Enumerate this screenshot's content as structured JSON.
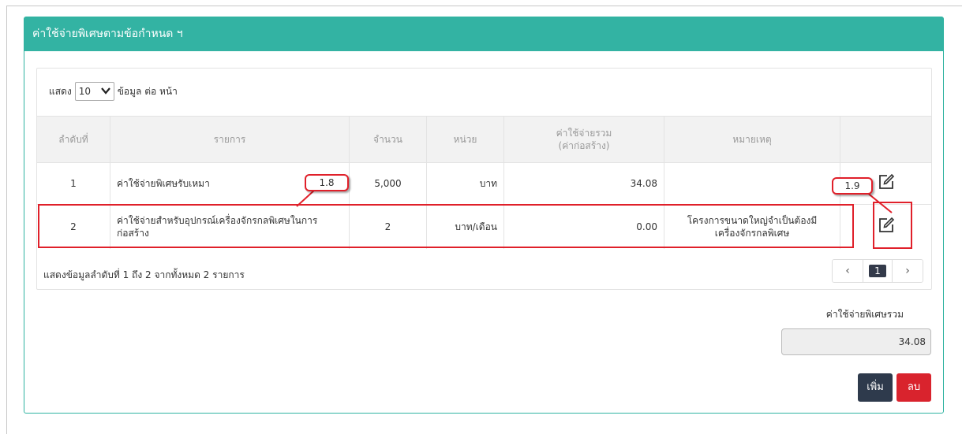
{
  "panel": {
    "title": "ค่าใช้จ่ายพิเศษตามข้อกำหนด ฯ"
  },
  "length_menu": {
    "prefix": "แสดง",
    "value": "10",
    "suffix": "ข้อมูล ต่อ หน้า"
  },
  "table": {
    "headers": {
      "no": "ลำดับที่",
      "item": "รายการ",
      "qty": "จำนวน",
      "unit": "หน่วย",
      "cost_line1": "ค่าใช้จ่ายรวม",
      "cost_line2": "(ค่าก่อสร้าง)",
      "note": "หมายเหตุ"
    },
    "rows": [
      {
        "no": "1",
        "item": "ค่าใช้จ่ายพิเศษรับเหมา",
        "qty": "5,000",
        "unit": "บาท",
        "cost": "34.08",
        "note": ""
      },
      {
        "no": "2",
        "item": "ค่าใช้จ่ายสำหรับอุปกรณ์เครื่องจักรกลพิเศษในการก่อสร้าง",
        "qty": "2",
        "unit": "บาท/เดือน",
        "cost": "0.00",
        "note": "โครงการขนาดใหญ่จำเป็นต้องมีเครื่องจักรกลพิเศษ"
      }
    ],
    "info": "แสดงข้อมูลลำดับที่ 1 ถึง 2 จากทั้งหมด 2 รายการ"
  },
  "pagination": {
    "prev": "‹",
    "current": "1",
    "next": "›"
  },
  "total": {
    "label": "ค่าใช้จ่ายพิเศษรวม",
    "value": "34.08"
  },
  "buttons": {
    "add": "เพิ่ม",
    "delete": "ลบ"
  },
  "annotations": {
    "callout_a": "1.8",
    "callout_b": "1.9"
  },
  "colors": {
    "header_teal": "#33b3a3",
    "highlight_red": "#e0202a",
    "add_button": "#2e3a4c",
    "delete_button": "#d9232d"
  },
  "icons": {
    "row_action": "edit-icon",
    "length_caret": "chevron-down-icon"
  }
}
